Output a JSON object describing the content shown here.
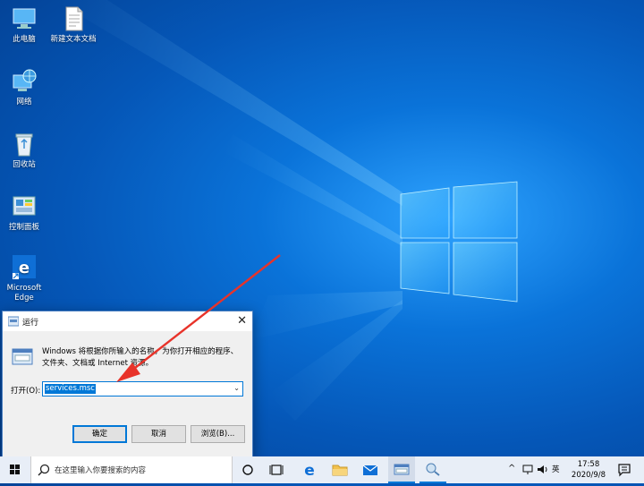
{
  "desktop": {
    "icons": [
      {
        "label": "此电脑"
      },
      {
        "label": "新建文本文档"
      },
      {
        "label": "网络"
      },
      {
        "label": "回收站"
      },
      {
        "label": "控制面板"
      },
      {
        "label": "Microsoft Edge"
      }
    ]
  },
  "run_dialog": {
    "title": "运行",
    "close": "✕",
    "description": "Windows 将根据你所输入的名称，为你打开相应的程序、文件夹、文档或 Internet 资源。",
    "open_label": "打开(O):",
    "input_value": "services.msc",
    "buttons": {
      "ok": "确定",
      "cancel": "取消",
      "browse": "浏览(B)..."
    }
  },
  "taskbar": {
    "search_placeholder": "在这里输入你要搜索的内容",
    "ime": "英",
    "time": "17:58",
    "date": "2020/9/8"
  },
  "colors": {
    "accent": "#0078d7",
    "arrow": "#e8332a"
  }
}
